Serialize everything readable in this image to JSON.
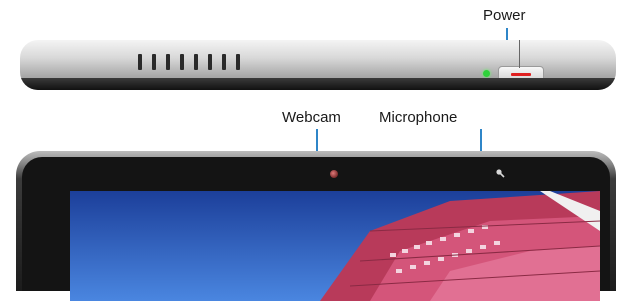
{
  "labels": {
    "power": "Power",
    "webcam": "Webcam",
    "microphone": "Microphone"
  },
  "colors": {
    "leader_line": "#2f86c8",
    "indicator_led": "#2fd13a",
    "power_button_mark": "#e02020"
  }
}
